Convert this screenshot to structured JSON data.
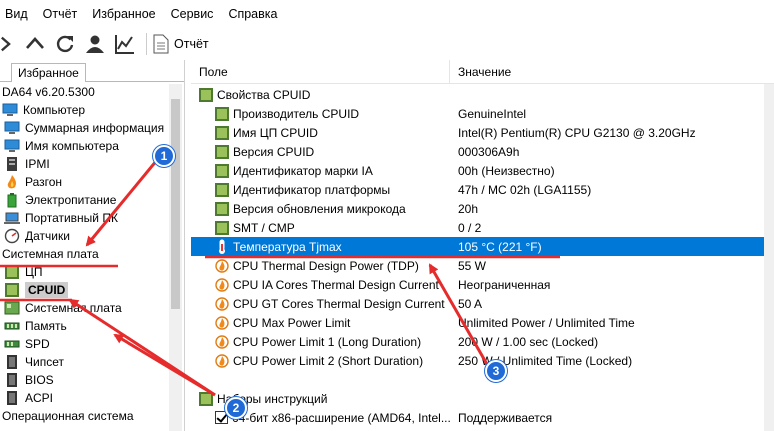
{
  "menu": [
    "Вид",
    "Отчёт",
    "Избранное",
    "Сервис",
    "Справка"
  ],
  "toolbar": {
    "report_label": "Отчёт"
  },
  "left": {
    "tab_label": "Избранное",
    "tree": [
      {
        "label": "DA64 v6.20.5300",
        "indent": 0,
        "icon": "none"
      },
      {
        "label": "Компьютер",
        "indent": 0,
        "icon": "computer-icon"
      },
      {
        "label": "Суммарная информация",
        "indent": 1,
        "icon": "summary-icon"
      },
      {
        "label": "Имя компьютера",
        "indent": 1,
        "icon": "computer-name-icon"
      },
      {
        "label": "IPMI",
        "indent": 1,
        "icon": "ipmi-icon"
      },
      {
        "label": "Разгон",
        "indent": 1,
        "icon": "flame-icon"
      },
      {
        "label": "Электропитание",
        "indent": 1,
        "icon": "power-icon"
      },
      {
        "label": "Портативный ПК",
        "indent": 1,
        "icon": "laptop-icon"
      },
      {
        "label": "Датчики",
        "indent": 1,
        "icon": "sensor-icon"
      },
      {
        "label": "Системная плата",
        "indent": 0,
        "icon": "none"
      },
      {
        "label": "ЦП",
        "indent": 1,
        "icon": "cpu-icon"
      },
      {
        "label": "CPUID",
        "indent": 1,
        "icon": "cpuid-icon",
        "selected": true
      },
      {
        "label": "Системная плата",
        "indent": 1,
        "icon": "motherboard-icon"
      },
      {
        "label": "Память",
        "indent": 1,
        "icon": "memory-icon"
      },
      {
        "label": "SPD",
        "indent": 1,
        "icon": "spd-icon"
      },
      {
        "label": "Чипсет",
        "indent": 1,
        "icon": "chipset-icon"
      },
      {
        "label": "BIOS",
        "indent": 1,
        "icon": "bios-icon"
      },
      {
        "label": "ACPI",
        "indent": 1,
        "icon": "acpi-icon"
      },
      {
        "label": "Операционная система",
        "indent": 0,
        "icon": "none"
      }
    ]
  },
  "right": {
    "col_field": "Поле",
    "col_value": "Значение",
    "rows": [
      {
        "field": "Свойства CPUID",
        "value": "",
        "icon": "square",
        "indent": 0
      },
      {
        "field": "Производитель CPUID",
        "value": "GenuineIntel",
        "icon": "square",
        "indent": 1
      },
      {
        "field": "Имя ЦП CPUID",
        "value": "Intel(R) Pentium(R) CPU G2130 @ 3.20GHz",
        "icon": "square",
        "indent": 1
      },
      {
        "field": "Версия CPUID",
        "value": "000306A9h",
        "icon": "square",
        "indent": 1
      },
      {
        "field": "Идентификатор марки IA",
        "value": "00h  (Неизвестно)",
        "icon": "square",
        "indent": 1
      },
      {
        "field": "Идентификатор платформы",
        "value": "47h / MC 02h  (LGA1155)",
        "icon": "square",
        "indent": 1
      },
      {
        "field": "Версия обновления микрокода",
        "value": "20h",
        "icon": "square",
        "indent": 1
      },
      {
        "field": "SMT / CMP",
        "value": "0 / 2",
        "icon": "square",
        "indent": 1
      },
      {
        "field": "Температура Tjmax",
        "value": "105 °C  (221 °F)",
        "icon": "therm",
        "indent": 1,
        "highlight": true
      },
      {
        "field": "CPU Thermal Design Power (TDP)",
        "value": "55 W",
        "icon": "flame",
        "indent": 1
      },
      {
        "field": "CPU IA Cores Thermal Design Current",
        "value": "Неограниченная",
        "icon": "flame",
        "indent": 1
      },
      {
        "field": "CPU GT Cores Thermal Design Current",
        "value": "50 A",
        "icon": "flame",
        "indent": 1
      },
      {
        "field": "CPU Max Power Limit",
        "value": "Unlimited Power / Unlimited Time",
        "icon": "flame",
        "indent": 1
      },
      {
        "field": "CPU Power Limit 1 (Long Duration)",
        "value": "200 W / 1.00 sec  (Locked)",
        "icon": "flame",
        "indent": 1
      },
      {
        "field": "CPU Power Limit 2 (Short Duration)",
        "value": "250 W / Unlimited Time  (Locked)",
        "icon": "flame",
        "indent": 1
      },
      {
        "field": "",
        "value": "",
        "icon": "none",
        "indent": 0
      },
      {
        "field": "Наборы инструкций",
        "value": "",
        "icon": "square",
        "indent": 0
      },
      {
        "field": "64-бит x86-расширение (AMD64, Intel...",
        "value": "Поддерживается",
        "icon": "check",
        "indent": 1
      }
    ]
  },
  "annotations": {
    "badge1": "1",
    "badge2": "2",
    "badge3": "3"
  },
  "colors": {
    "accent": "#0078d7",
    "arrow": "#e52b2b",
    "badge": "#1f6ad6"
  }
}
